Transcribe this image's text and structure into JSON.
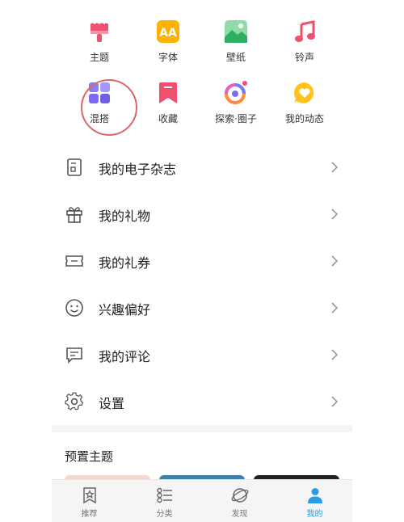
{
  "grid": {
    "items": [
      {
        "label": "主题",
        "icon": "brush-icon",
        "color": "#f0506e"
      },
      {
        "label": "字体",
        "icon": "font-icon",
        "color": "#ffb300"
      },
      {
        "label": "壁纸",
        "icon": "wallpaper-icon",
        "color": "#3fbf74"
      },
      {
        "label": "铃声",
        "icon": "music-note-icon",
        "color": "#f0506e"
      },
      {
        "label": "混搭",
        "icon": "mix-grid-icon",
        "color": "#7b6cf6"
      },
      {
        "label": "收藏",
        "icon": "bookmark-icon",
        "color": "#f0506e"
      },
      {
        "label": "探索·圈子",
        "icon": "explore-ring-icon",
        "color": "#ff7a59"
      },
      {
        "label": "我的动态",
        "icon": "heart-bubble-icon",
        "color": "#ffc21a"
      }
    ]
  },
  "menu": {
    "items": [
      {
        "label": "我的电子杂志",
        "icon": "magazine-icon"
      },
      {
        "label": "我的礼物",
        "icon": "gift-icon"
      },
      {
        "label": "我的礼券",
        "icon": "coupon-icon"
      },
      {
        "label": "兴趣偏好",
        "icon": "smile-icon"
      },
      {
        "label": "我的评论",
        "icon": "comment-icon"
      },
      {
        "label": "设置",
        "icon": "gear-icon"
      }
    ]
  },
  "preset_themes": {
    "title": "预置主题"
  },
  "tabbar": {
    "tabs": [
      {
        "label": "推荐",
        "icon": "star-bookmark-icon"
      },
      {
        "label": "分类",
        "icon": "category-list-icon"
      },
      {
        "label": "发现",
        "icon": "planet-icon"
      },
      {
        "label": "我的",
        "icon": "person-icon",
        "active": true
      }
    ],
    "active_color": "#2b9be6"
  }
}
